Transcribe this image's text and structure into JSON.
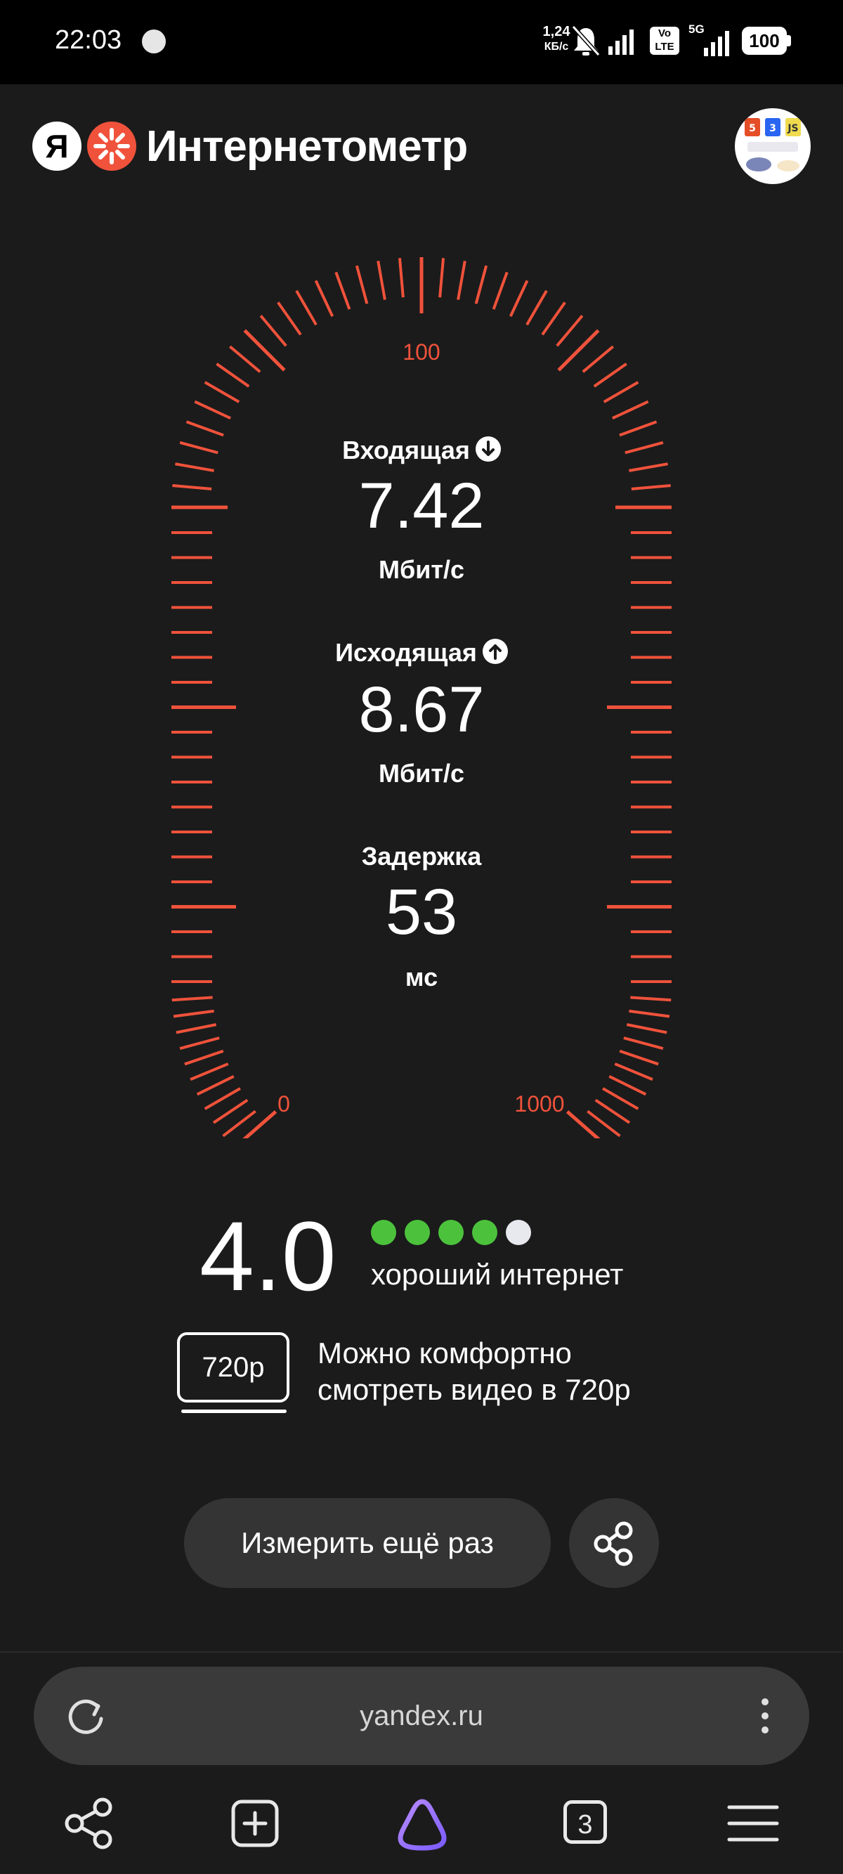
{
  "status_bar": {
    "time": "22:03",
    "net_speed_value": "1,24",
    "net_speed_unit": "КБ/с",
    "volte": "Vo LTE",
    "network": "5G",
    "battery": "100"
  },
  "header": {
    "logo_letter": "Я",
    "title": "Интернетометр",
    "avatar_icon": "webdev-avatar-icon"
  },
  "gauge": {
    "min_label": "0",
    "mid_label": "100",
    "max_label": "1000",
    "accent_color": "#f0523b"
  },
  "metrics": {
    "download": {
      "label": "Входящая",
      "value": "7.42",
      "unit": "Мбит/с"
    },
    "upload": {
      "label": "Исходящая",
      "value": "8.67",
      "unit": "Мбит/с"
    },
    "latency": {
      "label": "Задержка",
      "value": "53",
      "unit": "мс"
    }
  },
  "rating": {
    "score": "4.0",
    "filled_dots": 4,
    "total_dots": 5,
    "dot_color_on": "#4cc23c",
    "dot_color_off": "#e8e8ef",
    "quality_text": "хороший интернет"
  },
  "video": {
    "badge": "720p",
    "line1": "Можно комфортно",
    "line2": "смотреть видео в 720p"
  },
  "actions": {
    "measure_again": "Измерить ещё раз",
    "share_icon": "share-icon"
  },
  "address_bar": {
    "url": "yandex.ru"
  },
  "bottom_nav": {
    "tab_count": "3"
  }
}
